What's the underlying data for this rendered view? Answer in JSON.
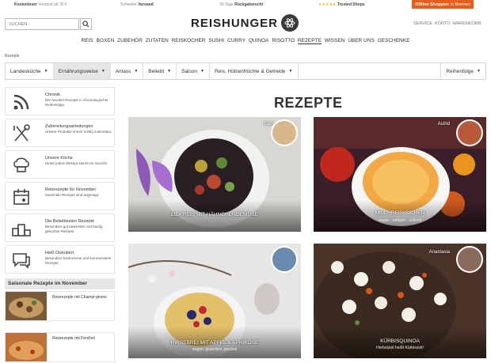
{
  "topbar": {
    "shipping_bold": "Kostenloser",
    "shipping_text": "Versand ab 30 €",
    "fast_text": "Schneller",
    "fast_bold": "Versand",
    "return_text": "30 Tage",
    "return_bold": "Rückgaberecht",
    "trusted_stars": "★★★★★",
    "trusted_text": "Trusted Shops",
    "offline_bold": "Offline Shoppen",
    "offline_text": "in Bremen"
  },
  "search": {
    "placeholder": "SUCHEN"
  },
  "brand": {
    "logo": "REISHUNGER"
  },
  "toplinks": [
    "SERVICE",
    "KONTO",
    "WARENKORB"
  ],
  "nav": [
    "REIS",
    "BOXEN",
    "ZUBEHÖR",
    "ZUTATEN",
    "REISKOCHER",
    "SUSHI",
    "CURRY",
    "QUINOA",
    "RISOTTO",
    "REZEPTE",
    "WISSEN",
    "ÜBER UNS",
    "GESCHENKE"
  ],
  "breadcrumb": "Rezepte",
  "filters": [
    "Landesküche",
    "Ernährungsweise",
    "Anlass",
    "Beliebt",
    "Saison",
    "Reis, Hülsenfrüchte & Getreide"
  ],
  "sort_label": "Reihenfolge",
  "sidebar": [
    {
      "title": "Chronik",
      "desc": "Die neusten Rezepte in chronologischer Reihenfolge."
    },
    {
      "title": "Zubereitungsanleitungen",
      "desc": "Unsere Produkte immer richtig zubereiten."
    },
    {
      "title": "Unsere Köche",
      "desc": "Hinter jedem Rezept steckt ein Gesicht."
    },
    {
      "title": "Reisrezepte für November",
      "desc": "Saisonale Rezepte sind angesagt."
    },
    {
      "title": "Die Beliebtesten Rezepte",
      "desc": "Besonders gut bewertete und häufig gekochte Rezepte."
    },
    {
      "title": "Heiß Diskutiert",
      "desc": "Besonders kontroverse und kommentierte Rezepte."
    }
  ],
  "seasonal": {
    "heading": "Saisonale Rezepte im November",
    "items": [
      "Reisrezepte mit Champi-gnons",
      "Reisrezepte mit Fenchel"
    ]
  },
  "page_title": "REZEPTE",
  "recipes": [
    {
      "title": "LILA REIS MIT HÄHNCHENGEMÜSE",
      "subtitle": "",
      "author": "Dani"
    },
    {
      "title": "MILCHREISKUCHEN",
      "subtitle": "vegan · einfach · schnell",
      "author": "Astrid"
    },
    {
      "title": "HIRSEBREI MIT APFEL & APRIKOSE",
      "subtitle": "vegan, glutenfrei, gesund",
      "author": ""
    },
    {
      "title": "KÜRBISQUINOA",
      "subtitle": "Herbstzeit heißt Kürbiszeit!",
      "author": "Anastasia"
    }
  ],
  "colors": {
    "accent": "#e85d1c",
    "stars": "#f0b400",
    "text": "#333333"
  }
}
